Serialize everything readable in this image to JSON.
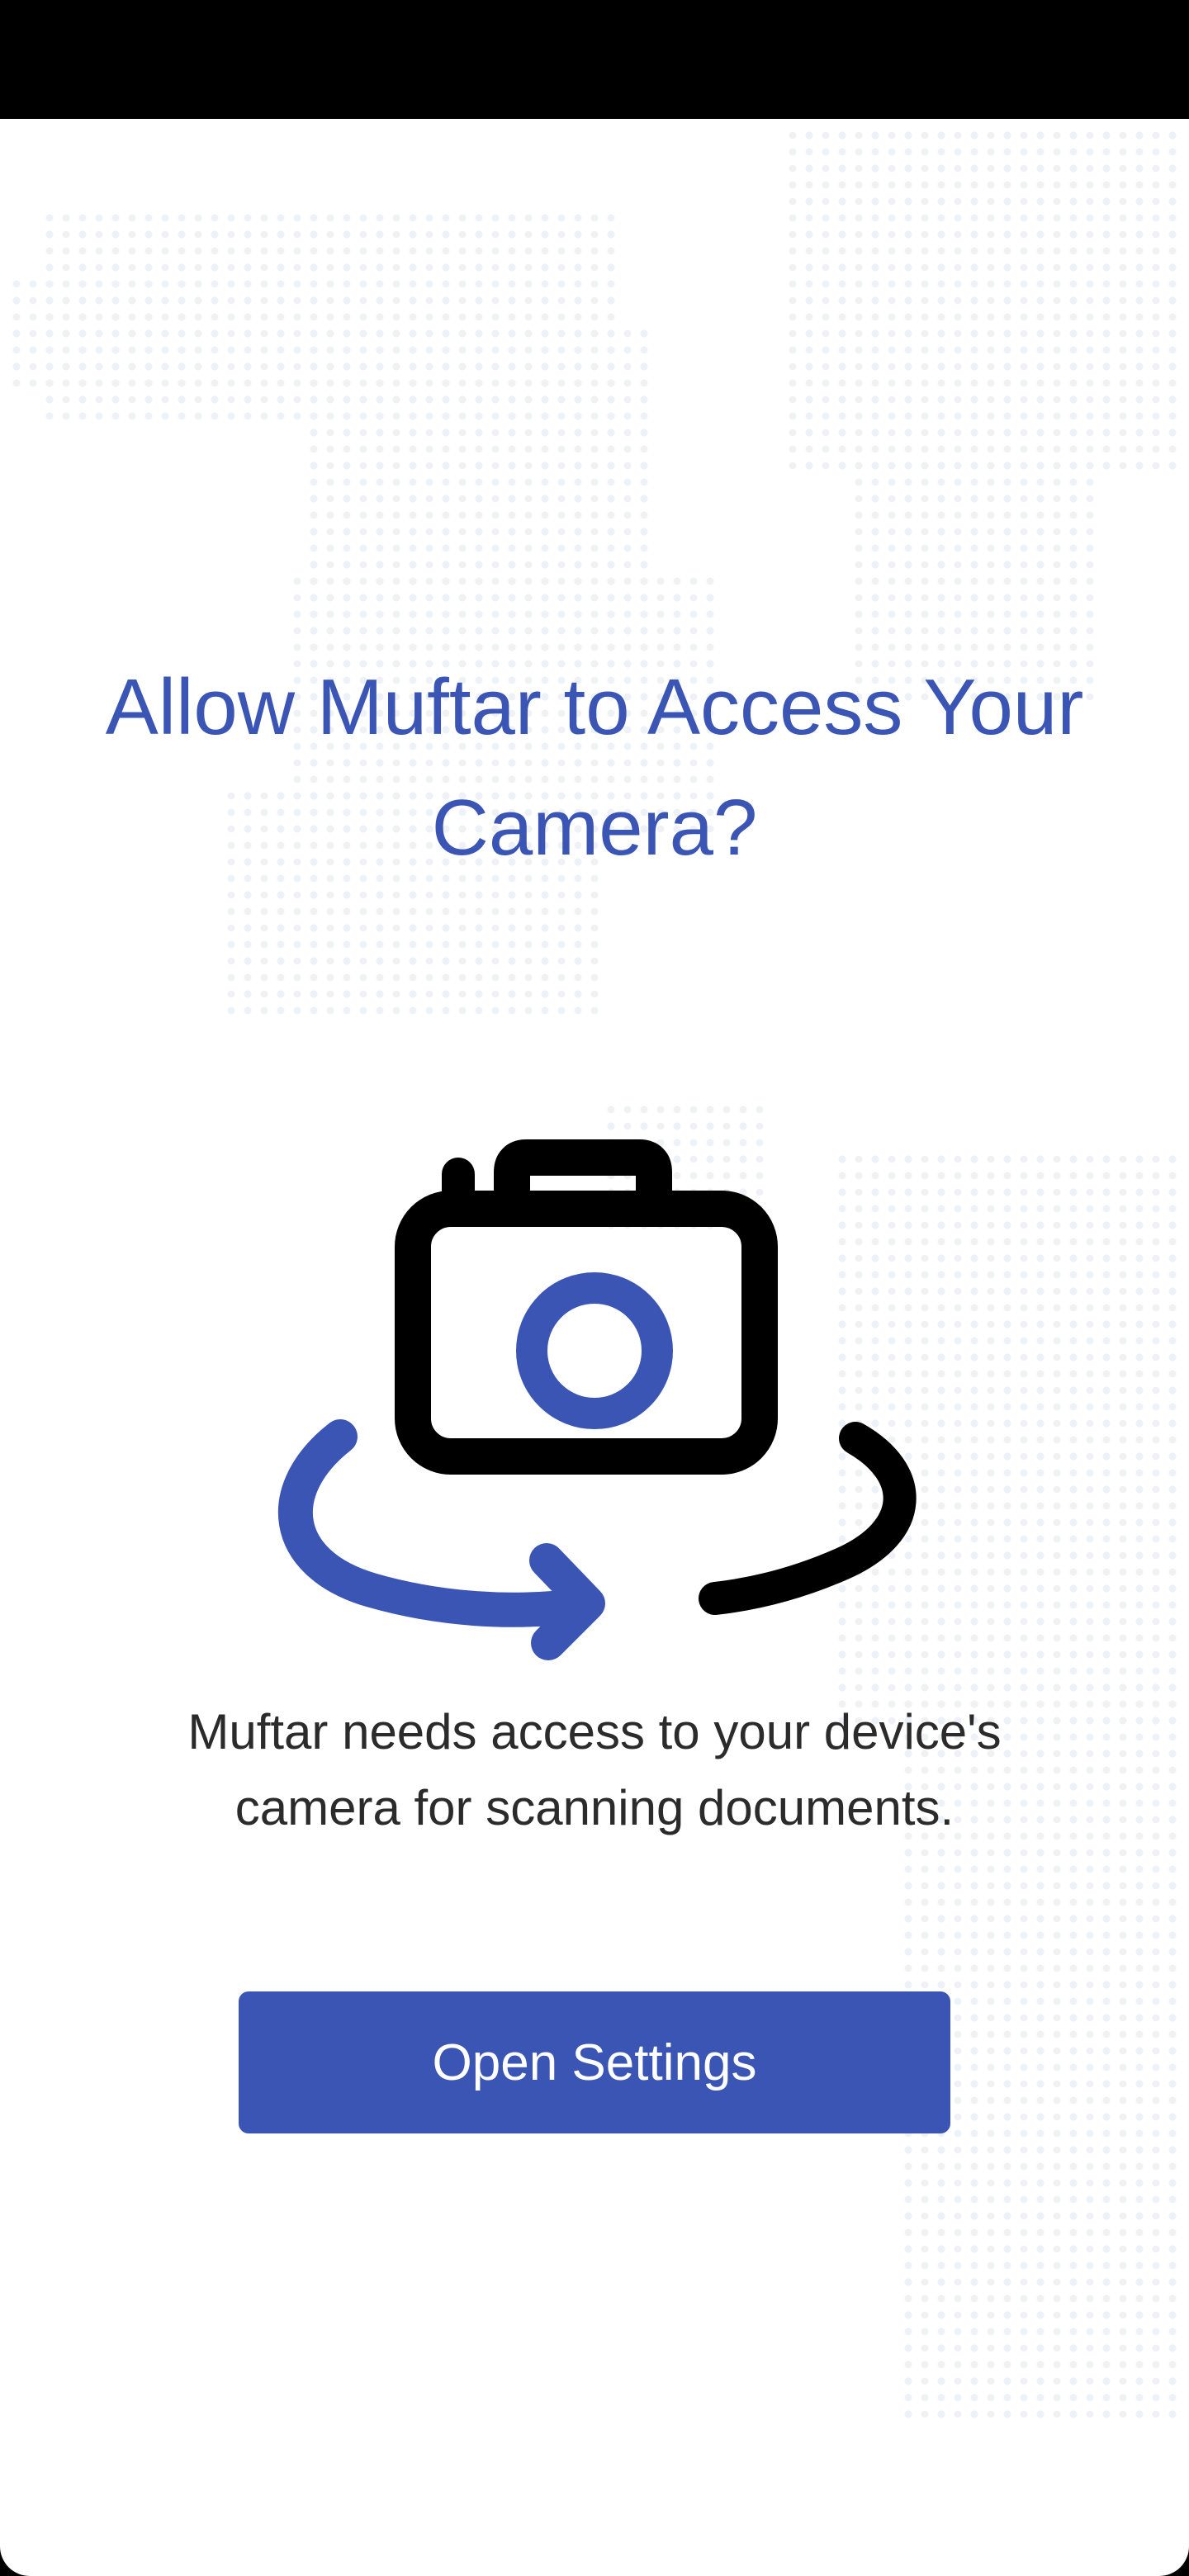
{
  "permission": {
    "title": "Allow Muftar to Access Your Camera?",
    "description": "Muftar needs access to your device's camera for scanning documents.",
    "button_label": "Open Settings"
  },
  "colors": {
    "accent": "#3b55b5",
    "icon_dark": "#000000",
    "text": "#2b2b2b",
    "background": "#ffffff",
    "map_dots": "#eef1f5"
  },
  "icons": {
    "illustration": "camera-rotate-icon"
  }
}
